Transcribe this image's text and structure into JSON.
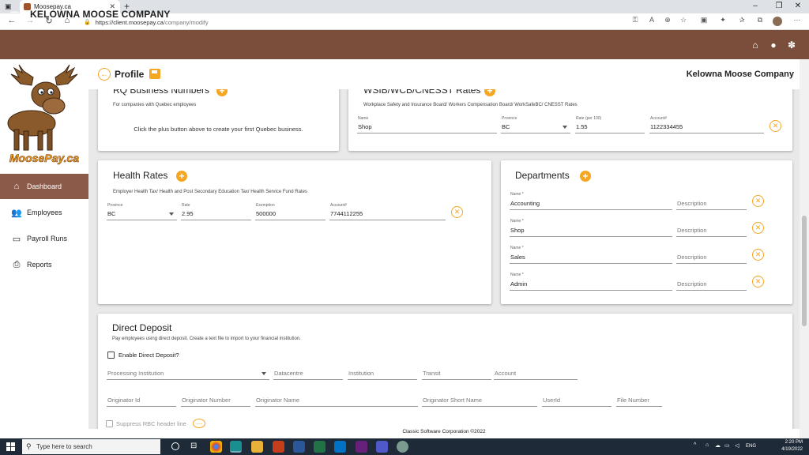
{
  "browser": {
    "tab_title": "Moosepay.ca",
    "close": "✕",
    "new_tab": "+",
    "url_host": "https://client.moosepay.ca",
    "url_path": "/company/modify",
    "minimize": "–",
    "maximize": "❐",
    "close_window": "✕"
  },
  "app": {
    "title": "KELOWNA MOOSE COMPANY",
    "brand_color": "#7a4e3a",
    "accent": "#f5a623",
    "logo_text": "MoosePay.ca"
  },
  "sidebar": {
    "items": [
      {
        "label": "Dashboard",
        "icon": "home-icon"
      },
      {
        "label": "Employees",
        "icon": "people-icon"
      },
      {
        "label": "Payroll Runs",
        "icon": "money-icon"
      },
      {
        "label": "Reports",
        "icon": "printer-icon"
      }
    ]
  },
  "profile": {
    "title": "Profile",
    "company": "Kelowna Moose Company"
  },
  "rq": {
    "title": "RQ Business Numbers",
    "subtitle": "For companies with Quebec employees",
    "empty": "Click the plus button above to create your first Quebec business."
  },
  "wsib": {
    "title": "WSIB/WCB/CNESST Rates",
    "subtitle": "Workplace Safety and Insurance Board/ Workers Compensation Board/ WorkSafeBC/ CNESST Rates",
    "row": {
      "name_label": "Name",
      "name": "Shop",
      "province_label": "Province",
      "province": "BC",
      "rate_label": "Rate (per 100)",
      "rate": "1.55",
      "account_label": "Account#",
      "account": "1122334455"
    }
  },
  "health": {
    "title": "Health Rates",
    "subtitle": "Employer Health Tax/ Health and Post Secondary Education Tax/ Health Service Fund Rates",
    "row": {
      "province_label": "Province",
      "province": "BC",
      "rate_label": "Rate",
      "rate": "2.95",
      "exemption_label": "Exemption",
      "exemption": "500000",
      "account_label": "Account#",
      "account": "7744112255"
    }
  },
  "departments": {
    "title": "Departments",
    "name_label": "Name *",
    "description_placeholder": "Description",
    "items": [
      "Accounting",
      "Shop",
      "Sales",
      "Admin"
    ]
  },
  "deposit": {
    "title": "Direct Deposit",
    "subtitle": "Pay employees using direct deposit. Create a text file to import to your financial institution.",
    "enable_label": "Enable Direct Deposit?",
    "row1": [
      "Processing Institution",
      "Datacentre",
      "Institution",
      "Transit",
      "Account"
    ],
    "row2": [
      "Originator Id",
      "Originator Number",
      "Originator Name",
      "Originator Short Name",
      "UserId",
      "File Number"
    ],
    "suppress_label": "Suppress RBC header line"
  },
  "footer": "Classic Software Corporation  ©2022",
  "taskbar": {
    "search_placeholder": "Type here to search",
    "time": "2:20 PM",
    "date": "4/19/2022",
    "lang": "ENG"
  }
}
